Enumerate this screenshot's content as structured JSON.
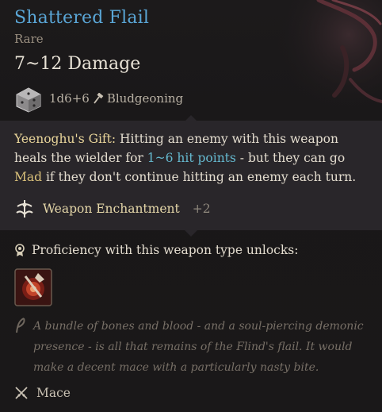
{
  "tooltip": {
    "item_name": "Shattered Flail",
    "rarity": "Rare",
    "damage_summary": "7~12 Damage",
    "damage_dice": "1d6+6",
    "damage_type": "Bludgeoning",
    "passive": {
      "name": "Yeenoghu's Gift:",
      "text_1": " Hitting an enemy with this weapon heals the wielder for ",
      "highlight": "1~6 hit points",
      "text_2": " - but they can go ",
      "condition": "Mad",
      "text_3": " if they don't continue hitting an enemy each turn."
    },
    "enchantment": {
      "label": "Weapon Enchantment",
      "bonus": "+2"
    },
    "proficiency_heading": "Proficiency with this weapon type unlocks:",
    "flavor_text": "A bundle of bones and blood - and a soul-piercing demonic presence - is all that remains of the Flind's flail. It would make a decent mace with a particularly nasty bite.",
    "weapon_type": "Mace",
    "colors": {
      "title": "#5aa6d6",
      "highlight": "#65b9cf",
      "gold": "#e9d59a",
      "panel": "#29262a"
    },
    "icons": [
      "d6-die-icon",
      "hammer-icon",
      "enchantment-icon",
      "medal-icon",
      "proficiency-action-icon",
      "quill-icon",
      "crossed-swords-icon"
    ]
  }
}
